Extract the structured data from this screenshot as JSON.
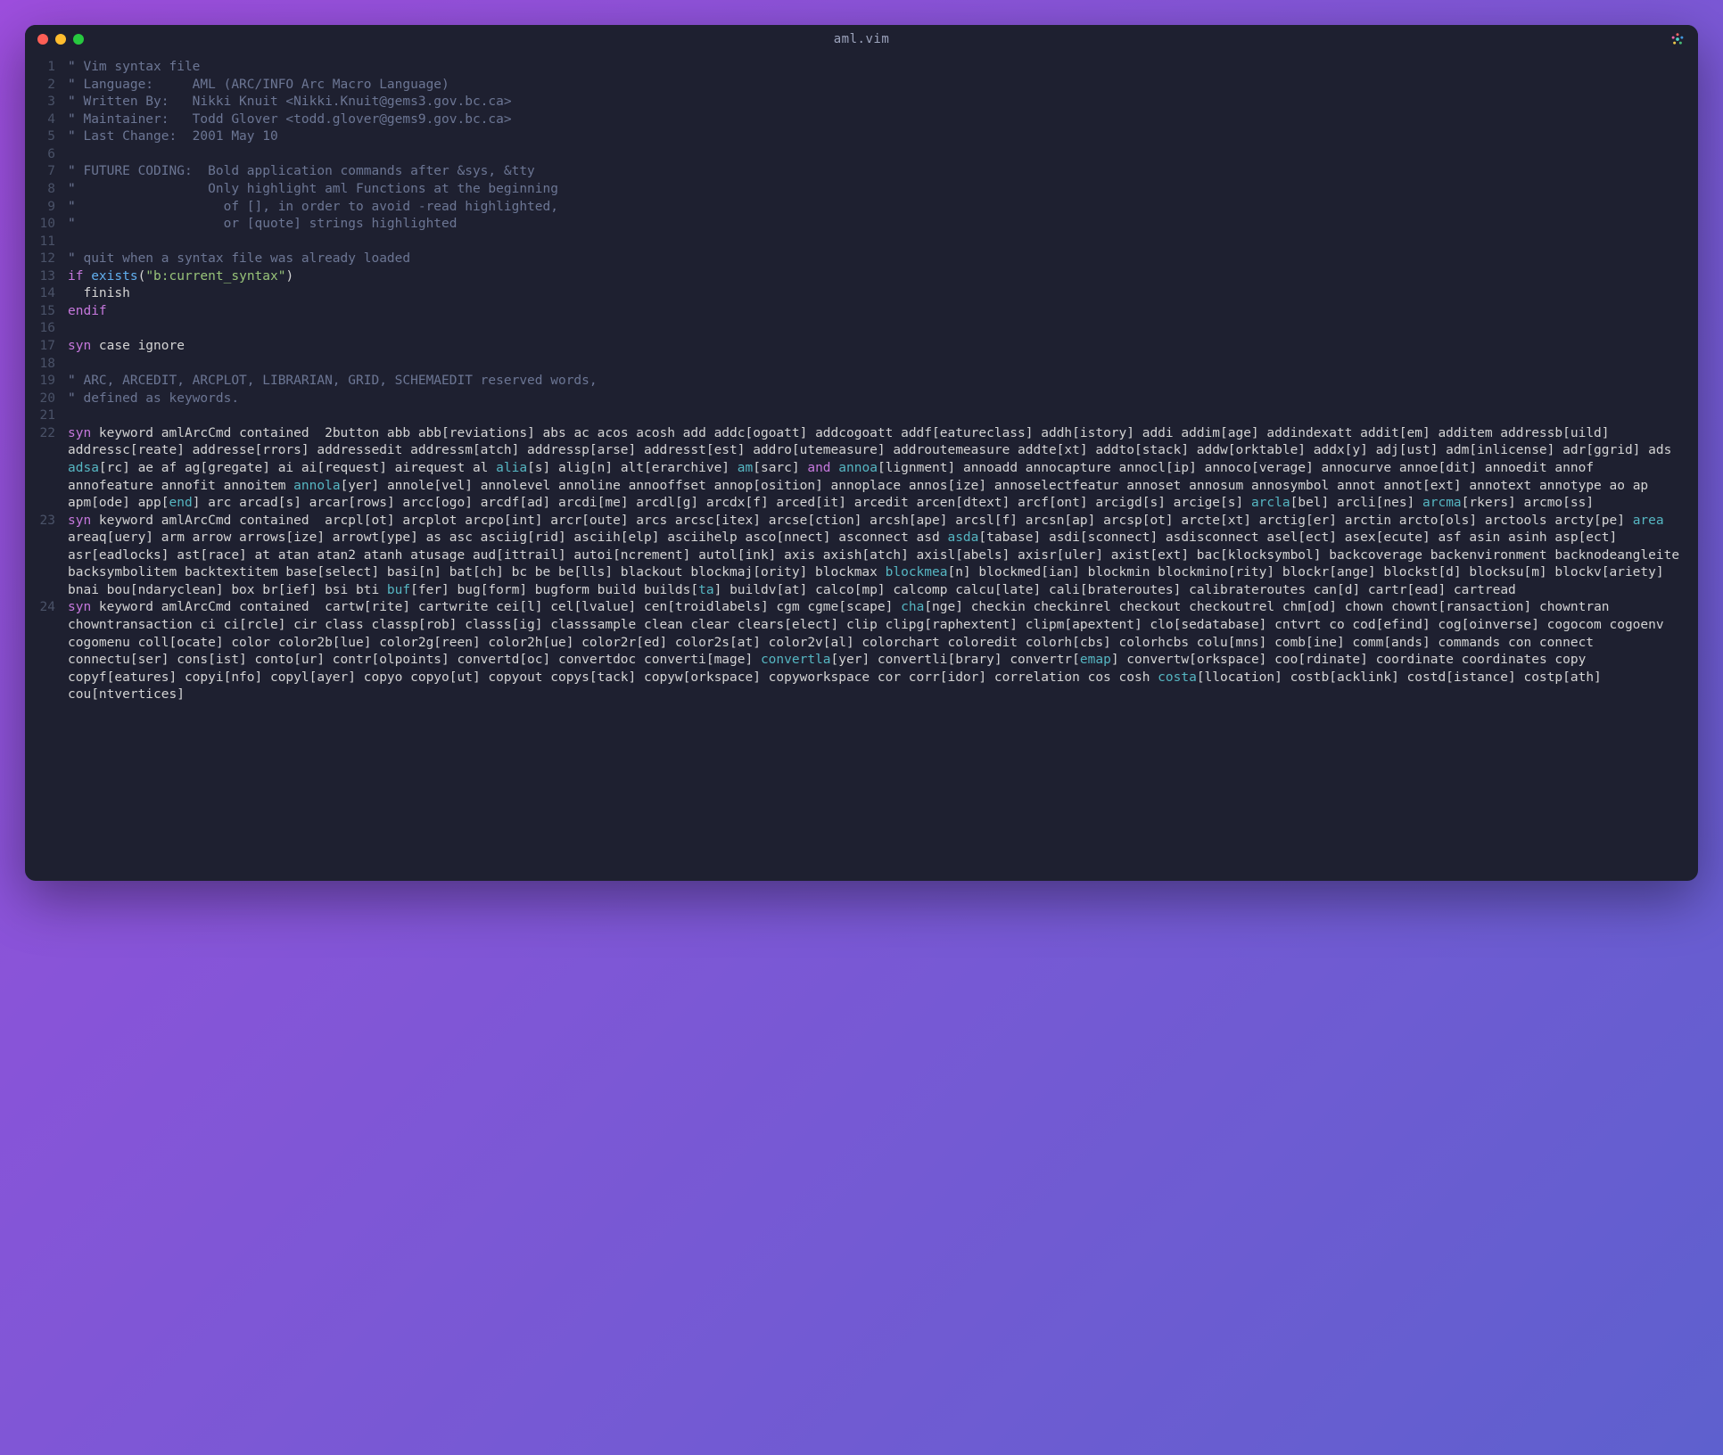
{
  "title": "aml.vim",
  "lines": [
    {
      "n": 1,
      "t": [
        [
          "\" Vim syntax file",
          "comment"
        ]
      ]
    },
    {
      "n": 2,
      "t": [
        [
          "\" Language:     AML (ARC/INFO Arc Macro Language)",
          "comment"
        ]
      ]
    },
    {
      "n": 3,
      "t": [
        [
          "\" Written By:   Nikki Knuit <Nikki.Knuit@gems3.gov.bc.ca>",
          "comment"
        ]
      ]
    },
    {
      "n": 4,
      "t": [
        [
          "\" Maintainer:   Todd Glover <todd.glover@gems9.gov.bc.ca>",
          "comment"
        ]
      ]
    },
    {
      "n": 5,
      "t": [
        [
          "\" Last Change:  2001 May 10",
          "comment"
        ]
      ]
    },
    {
      "n": 6,
      "t": [
        [
          "",
          "plain"
        ]
      ]
    },
    {
      "n": 7,
      "t": [
        [
          "\" FUTURE CODING:  Bold application commands after &sys, &tty",
          "comment"
        ]
      ]
    },
    {
      "n": 8,
      "t": [
        [
          "\"                 Only highlight aml Functions at the beginning",
          "comment"
        ]
      ]
    },
    {
      "n": 9,
      "t": [
        [
          "\"                   of [], in order to avoid -read highlighted,",
          "comment"
        ]
      ]
    },
    {
      "n": 10,
      "t": [
        [
          "\"                   or [quote] strings highlighted",
          "comment"
        ]
      ]
    },
    {
      "n": 11,
      "t": [
        [
          "",
          "plain"
        ]
      ]
    },
    {
      "n": 12,
      "t": [
        [
          "\" quit when a syntax file was already loaded",
          "comment"
        ]
      ]
    },
    {
      "n": 13,
      "t": [
        [
          "if",
          "keyword"
        ],
        [
          " ",
          "plain"
        ],
        [
          "exists",
          "func"
        ],
        [
          "(",
          "plain"
        ],
        [
          "\"b:current_syntax\"",
          "string"
        ],
        [
          ")",
          "plain"
        ]
      ]
    },
    {
      "n": 14,
      "t": [
        [
          "  finish",
          "plain"
        ]
      ]
    },
    {
      "n": 15,
      "t": [
        [
          "endif",
          "keyword"
        ]
      ]
    },
    {
      "n": 16,
      "t": [
        [
          "",
          "plain"
        ]
      ]
    },
    {
      "n": 17,
      "t": [
        [
          "syn",
          "keyword"
        ],
        [
          " case ignore",
          "plain"
        ]
      ]
    },
    {
      "n": 18,
      "t": [
        [
          "",
          "plain"
        ]
      ]
    },
    {
      "n": 19,
      "t": [
        [
          "\" ARC, ARCEDIT, ARCPLOT, LIBRARIAN, GRID, SCHEMAEDIT reserved words,",
          "comment"
        ]
      ]
    },
    {
      "n": 20,
      "t": [
        [
          "\" defined as keywords.",
          "comment"
        ]
      ]
    },
    {
      "n": 21,
      "t": [
        [
          "",
          "plain"
        ]
      ]
    },
    {
      "n": 22,
      "t": [
        [
          "syn",
          "keyword"
        ],
        [
          " keyword amlArcCmd contained  2button abb abb[reviations] abs ac acos acosh add addc[ogoatt] addcogoatt addf[eatureclass] addh[istory] addi addim[age] addindexatt addit[em] additem addressb[uild] addressc[reate] addresse[rrors] addressedit addressm[atch] addressp[arse] addresst[est] addro[utemeasure] addroutemeasure addte[xt] addto[stack] addw[orktable] addx[y] adj[ust] adm[inlicense] adr[ggrid] ads ",
          "plain"
        ],
        [
          "adsa",
          "type"
        ],
        [
          "[rc] ae af ag[gregate] ai ai[request] airequest al ",
          "plain"
        ],
        [
          "alia",
          "type"
        ],
        [
          "[s] alig[n] alt[erarchive] ",
          "plain"
        ],
        [
          "am",
          "type"
        ],
        [
          "[sarc] ",
          "plain"
        ],
        [
          "and",
          "keyword"
        ],
        [
          " ",
          "plain"
        ],
        [
          "annoa",
          "type"
        ],
        [
          "[lignment] annoadd annocapture annocl[ip] annoco[verage] annocurve annoe[dit] annoedit annof annofeature annofit annoitem ",
          "plain"
        ],
        [
          "annola",
          "type"
        ],
        [
          "[yer] annole[vel] annolevel annoline annooffset annop[osition] annoplace annos[ize] annoselectfeatur annoset annosum annosymbol annot annot[ext] annotext annotype ao ap apm[ode] app[",
          "plain"
        ],
        [
          "end",
          "type"
        ],
        [
          "] arc arcad[s] arcar[rows] arcc[ogo] arcdf[ad] arcdi[me] arcdl[g] arcdx[f] arced[it] arcedit arcen[dtext] arcf[ont] arcigd[s] arcige[s] ",
          "plain"
        ],
        [
          "arcla",
          "type"
        ],
        [
          "[bel] arcli[nes] ",
          "plain"
        ],
        [
          "arcma",
          "type"
        ],
        [
          "[rkers] arcmo[ss]",
          "plain"
        ]
      ]
    },
    {
      "n": 23,
      "t": [
        [
          "syn",
          "keyword"
        ],
        [
          " keyword amlArcCmd contained  arcpl[ot] arcplot arcpo[int] arcr[oute] arcs arcsc[itex] arcse[ction] arcsh[ape] arcsl[f] arcsn[ap] arcsp[ot] arcte[xt] arctig[er] arctin arcto[ols] arctools arcty[pe] ",
          "plain"
        ],
        [
          "area",
          "type"
        ],
        [
          " areaq[uery] arm arrow arrows[ize] arrowt[ype] as asc asciig[rid] asciih[elp] asciihelp asco[nnect] asconnect asd ",
          "plain"
        ],
        [
          "asda",
          "type"
        ],
        [
          "[tabase] asdi[sconnect] asdisconnect asel[ect] asex[ecute] asf asin asinh asp[ect] asr[eadlocks] ast[race] at atan atan2 atanh atusage aud[ittrail] autoi[ncrement] autol[ink] axis axish[atch] axisl[abels] axisr[uler] axist[ext] bac[klocksymbol] backcoverage backenvironment backnodeangleite backsymbolitem backtextitem base[select] basi[n] bat[ch] bc be be[lls] blackout blockmaj[ority] blockmax ",
          "plain"
        ],
        [
          "blockmea",
          "type"
        ],
        [
          "[n] blockmed[ian] blockmin blockmino[rity] blockr[ange] blockst[d] blocksu[m] blockv[ariety] bnai bou[ndaryclean] box br[ief] bsi bti ",
          "plain"
        ],
        [
          "buf",
          "type"
        ],
        [
          "[fer] bug[form] bugform build builds[",
          "plain"
        ],
        [
          "ta",
          "type"
        ],
        [
          "] buildv[at] calco[mp] calcomp calcu[late] cali[brateroutes] calibrateroutes can[d] cartr[ead] cartread",
          "plain"
        ]
      ]
    },
    {
      "n": 24,
      "t": [
        [
          "syn",
          "keyword"
        ],
        [
          " keyword amlArcCmd contained  cartw[rite] cartwrite cei[l] cel[lvalue] cen[troidlabels] cgm cgme[scape] ",
          "plain"
        ],
        [
          "cha",
          "type"
        ],
        [
          "[nge] checkin checkinrel checkout checkoutrel chm[od] chown chownt[ransaction] chowntran chowntransaction ci ci[rcle] cir class classp[rob] classs[ig] classsample clean clear clears[elect] clip clipg[raphextent] clipm[apextent] clo[sedatabase] cntvrt co cod[efind] cog[oinverse] cogocom cogoenv cogomenu coll[ocate] color color2b[lue] color2g[reen] color2h[ue] color2r[ed] color2s[at] color2v[al] colorchart coloredit colorh[cbs] colorhcbs colu[mns] comb[ine] comm[ands] commands con connect connectu[ser] cons[ist] conto[ur] contr[olpoints] convertd[oc] convertdoc converti[mage] ",
          "plain"
        ],
        [
          "convertla",
          "type"
        ],
        [
          "[yer] convertli[brary] convertr[",
          "plain"
        ],
        [
          "emap",
          "type"
        ],
        [
          "] convertw[orkspace] coo[rdinate] coordinate coordinates copy copyf[eatures] copyi[nfo] copyl[ayer] copyo copyo[ut] copyout copys[tack] copyw[orkspace] copyworkspace cor corr[idor] correlation cos cosh ",
          "plain"
        ],
        [
          "costa",
          "type"
        ],
        [
          "[llocation] costb[acklink] costd[istance] costp[ath] cou[ntvertices]",
          "plain"
        ]
      ]
    }
  ]
}
